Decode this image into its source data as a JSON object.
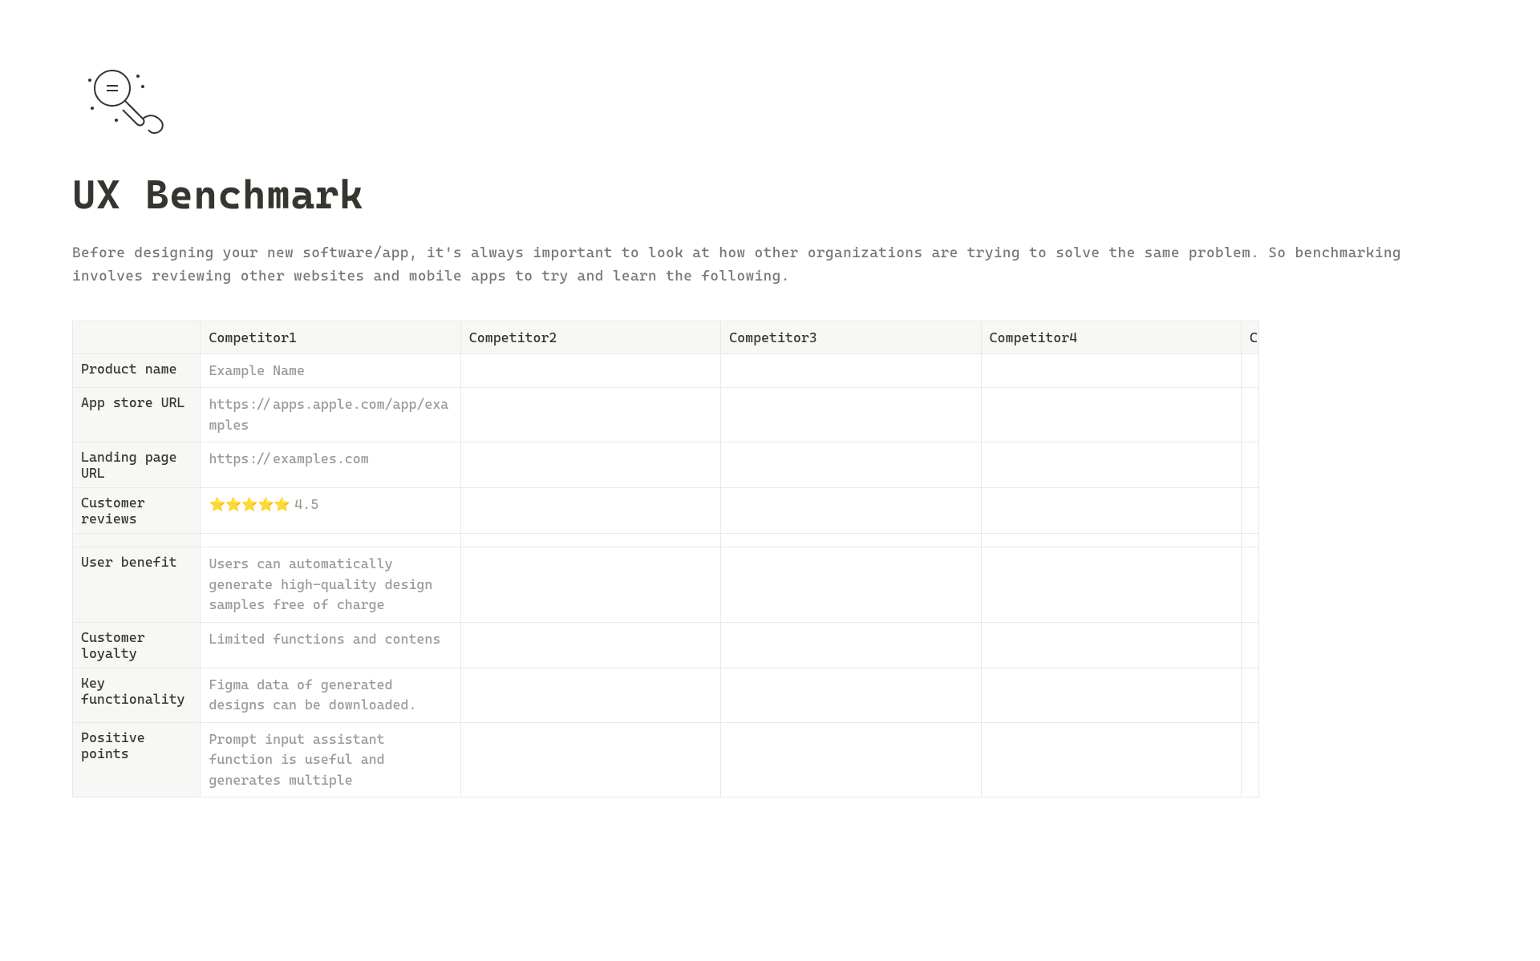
{
  "page": {
    "title": "UX Benchmark",
    "intro": "Before designing your new software/app, it's always important to look at how other organizations are trying to solve the same problem. So benchmarking involves reviewing other websites and mobile apps to try and learn the following."
  },
  "table": {
    "headers": [
      "",
      "Competitor1",
      "Competitor2",
      "Competitor3",
      "Competitor4",
      "C"
    ],
    "rows": [
      {
        "label": "Product name",
        "cells": [
          "Example Name",
          "",
          "",
          "",
          ""
        ]
      },
      {
        "label": "App store URL",
        "cells": [
          "https://apps.apple.com/app/examples",
          "",
          "",
          "",
          ""
        ]
      },
      {
        "label": "Landing page URL",
        "cells": [
          "https://examples.com",
          "",
          "",
          "",
          ""
        ]
      },
      {
        "label": "Customer reviews",
        "cells": [
          "⭐⭐⭐⭐⭐ 4.5",
          "",
          "",
          "",
          ""
        ],
        "stars": "⭐⭐⭐⭐⭐",
        "rating": "4.5"
      },
      {
        "label": "",
        "cells": [
          "",
          "",
          "",
          "",
          ""
        ]
      },
      {
        "label": "User benefit",
        "cells": [
          "Users can automatically generate high-quality design samples free of charge",
          "",
          "",
          "",
          ""
        ]
      },
      {
        "label": "Customer loyalty",
        "cells": [
          "Limited functions and contens",
          "",
          "",
          "",
          ""
        ]
      },
      {
        "label": "Key functionality",
        "cells": [
          "Figma data of generated designs can be downloaded.",
          "",
          "",
          "",
          ""
        ]
      },
      {
        "label": "Positive points",
        "cells": [
          "Prompt input assistant function is useful and generates multiple",
          "",
          "",
          "",
          ""
        ]
      }
    ]
  }
}
